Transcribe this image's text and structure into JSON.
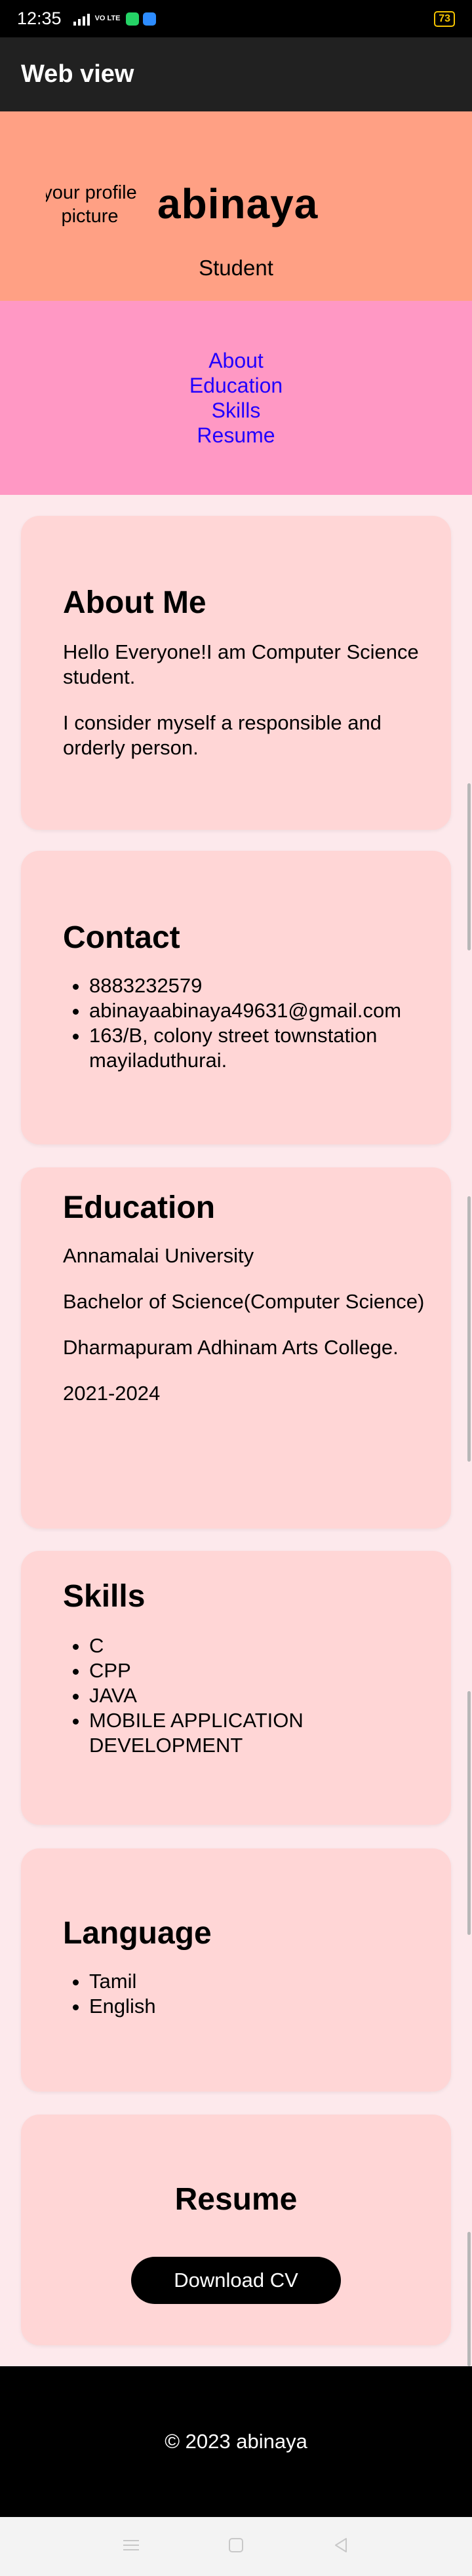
{
  "status_bar": {
    "time": "12:35",
    "volte": "VO LTE",
    "battery": "73"
  },
  "app_bar": {
    "title": "Web view"
  },
  "hero": {
    "profile_alt_line1": "your profile",
    "profile_alt_line2": "picture",
    "name": "abinaya",
    "role": "Student"
  },
  "nav": {
    "items": [
      "About",
      "Education",
      "Skills",
      "Resume"
    ]
  },
  "about": {
    "heading": "About Me",
    "para1": "Hello Everyone!I am Computer Science student.",
    "para2": "I consider myself a responsible and orderly person."
  },
  "contact": {
    "heading": "Contact",
    "items": [
      "8883232579",
      "abinayaabinaya49631@gmail.com",
      "163/B, colony street townstation mayiladuthurai."
    ]
  },
  "education": {
    "heading": "Education",
    "university": "Annamalai University",
    "degree": "Bachelor of Science(Computer Science)",
    "college": "Dharmapuram Adhinam Arts College.",
    "years": "2021-2024"
  },
  "skills": {
    "heading": "Skills",
    "items": [
      "C",
      "CPP",
      "JAVA",
      "MOBILE APPLICATION DEVELOPMENT"
    ]
  },
  "language": {
    "heading": "Language",
    "items": [
      "Tamil",
      "English"
    ]
  },
  "resume": {
    "heading": "Resume",
    "button": "Download CV"
  },
  "footer": {
    "text": "© 2023 abinaya"
  }
}
